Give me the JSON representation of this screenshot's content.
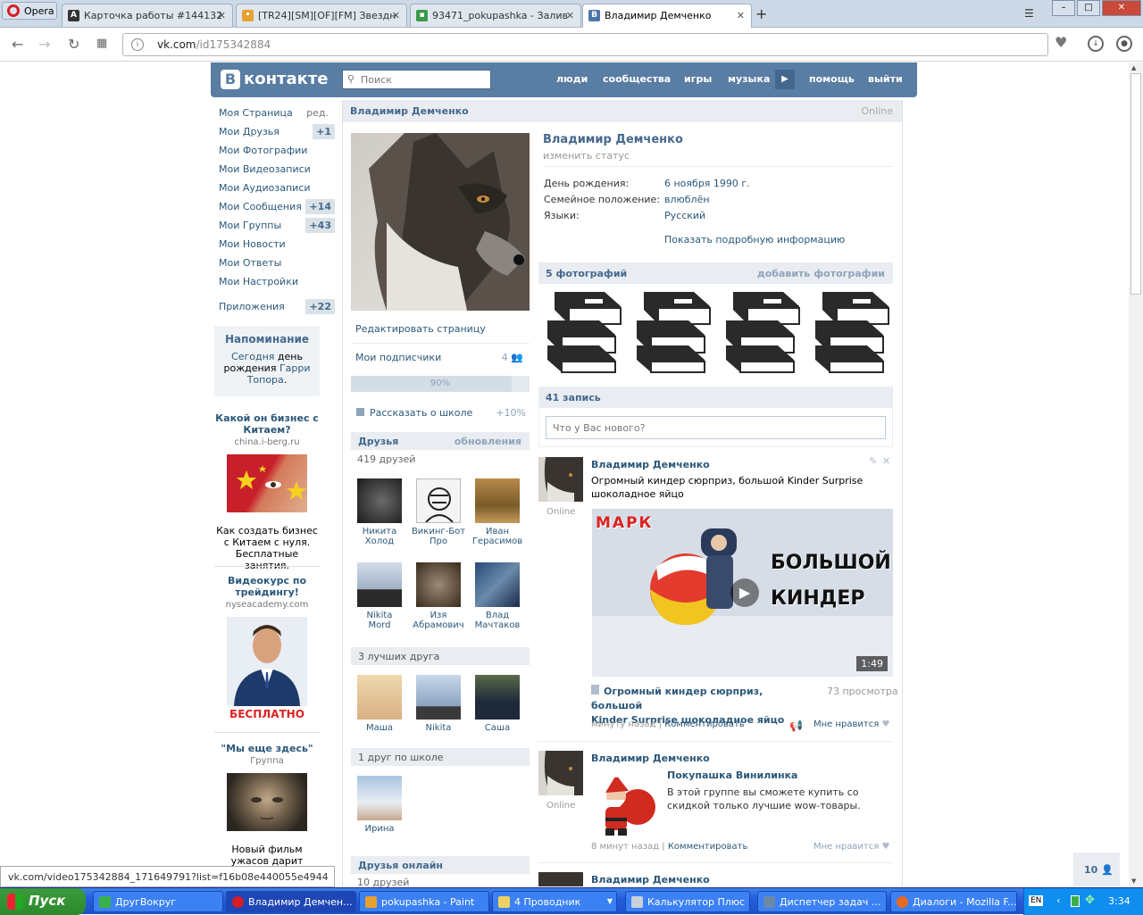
{
  "browser": {
    "opera_label": "Opera",
    "tabs": [
      {
        "label": "Карточка работы #144132"
      },
      {
        "label": "[TR24][SM][OF][FM] Звездн"
      },
      {
        "label": "93471_pokupashka - Залив"
      },
      {
        "label": "Владимир Демченко"
      }
    ],
    "url_host": "vk.com",
    "url_path": "/id175342884"
  },
  "vk": {
    "logo": "контакте",
    "search_placeholder": "Поиск",
    "nav": {
      "people": "люди",
      "communities": "сообщества",
      "games": "игры",
      "music": "музыка",
      "help": "помощь",
      "logout": "выйти"
    }
  },
  "left_menu": [
    {
      "label": "Моя Страница",
      "badge": "ред."
    },
    {
      "label": "Мои Друзья",
      "badge": "+1"
    },
    {
      "label": "Мои Фотографии",
      "badge": ""
    },
    {
      "label": "Мои Видеозаписи",
      "badge": ""
    },
    {
      "label": "Мои Аудиозаписи",
      "badge": ""
    },
    {
      "label": "Мои Сообщения",
      "badge": "+14"
    },
    {
      "label": "Мои Группы",
      "badge": "+43"
    },
    {
      "label": "Мои Новости",
      "badge": ""
    },
    {
      "label": "Мои Ответы",
      "badge": ""
    },
    {
      "label": "Мои Настройки",
      "badge": ""
    },
    {
      "label": "Приложения",
      "badge": "+22"
    }
  ],
  "reminder": {
    "title": "Напоминание",
    "t1": "Сегодня",
    "t2": "день",
    "t3": "рождения",
    "t4": "Гарри Топора",
    "t5": "."
  },
  "ads": [
    {
      "title": "Какой он бизнес с Китаем?",
      "site": "china.i-berg.ru",
      "text": "Как создать бизнес с Китаем с нуля. Бесплатные занятия."
    },
    {
      "title": "Видеокурс по трейдингу!",
      "site": "nyseacademy.com",
      "banner": "БЕСПЛАТНО"
    },
    {
      "title": "\"Мы еще здесь\"",
      "site": "Группа",
      "text": "Новый фильм ужасов дарит подарки"
    }
  ],
  "profile": {
    "header_name": "Владимир Демченко",
    "header_status": "Online",
    "name": "Владимир Демченко",
    "status_link": "изменить статус",
    "info": [
      {
        "label": "День рождения:",
        "value": "6 ноября 1990 г."
      },
      {
        "label": "Семейное положение:",
        "value": "влюблён"
      },
      {
        "label": "Языки:",
        "value": "Русский"
      }
    ],
    "more_info": "Показать подробную информацию",
    "edit_page": "Редактировать страницу",
    "subscribers": "Мои подписчики",
    "subscribers_count": "4",
    "progress_label": "90%",
    "progress_value": 0.9,
    "school": "Рассказать о школе",
    "school_bonus": "+10%"
  },
  "photos": {
    "title": "5 фотографий",
    "add": "добавить фотографии"
  },
  "friends": {
    "title": "Друзья",
    "updates": "обновления",
    "count": "419 друзей",
    "list": [
      {
        "n1": "Никита",
        "n2": "Холод"
      },
      {
        "n1": "Викинг-Бот",
        "n2": "Про"
      },
      {
        "n1": "Иван",
        "n2": "Герасимов"
      },
      {
        "n1": "Nikita",
        "n2": "Mord"
      },
      {
        "n1": "Изя",
        "n2": "Абрамович"
      },
      {
        "n1": "Влад",
        "n2": "Мачтаков"
      }
    ],
    "best_title": "3 лучших друга",
    "best": [
      {
        "n1": "Маша"
      },
      {
        "n1": "Nikita"
      },
      {
        "n1": "Саша"
      }
    ],
    "school_title": "1 друг по школе",
    "school": [
      {
        "n1": "Ирина"
      }
    ],
    "online_title": "Друзья онлайн",
    "online_count": "10 друзей"
  },
  "wall": {
    "count": "41 запись",
    "placeholder": "Что у Вас нового?",
    "posts": [
      {
        "author": "Владимир Демченко",
        "online": "Online",
        "text1": "Огромный киндер сюрприз, большой Kinder Surprise",
        "text2": "шоколадное яйцо",
        "video_duration": "1:49",
        "video_title1": "Огромный киндер сюрприз, большой",
        "video_title2": "Kinder Surprise шоколадное яйцо",
        "views": "73 просмотра",
        "overlay1": "МАРК",
        "overlay2": "БОЛЬШОЙ",
        "overlay3": "КИНДЕР",
        "time": "минуту назад",
        "comment": "Комментировать",
        "like": "Мне нравится"
      },
      {
        "author": "Владимир Демченко",
        "online": "Online",
        "group": "Покупашка Винилинка",
        "text1": "В этой группе вы сможете купить со",
        "text2": "скидкой только лучшие wow-товары.",
        "time": "8 минут назад",
        "comment": "Комментировать",
        "like": "Мне нравится"
      },
      {
        "author": "Владимир Демченко"
      }
    ]
  },
  "status_url": "vk.com/video175342884_171649791?list=f16b08e440055e4944",
  "online_counter": "10",
  "taskbar": {
    "start": "Пуск",
    "tasks": [
      "ДругВокруг",
      "Владимир Демчен...",
      "pokupashka - Paint",
      "4 Проводник",
      "Калькулятор Плюс",
      "Диспетчер задач ...",
      "Диалоги - Mozilla F..."
    ],
    "lang": "EN",
    "time": "3:34"
  }
}
